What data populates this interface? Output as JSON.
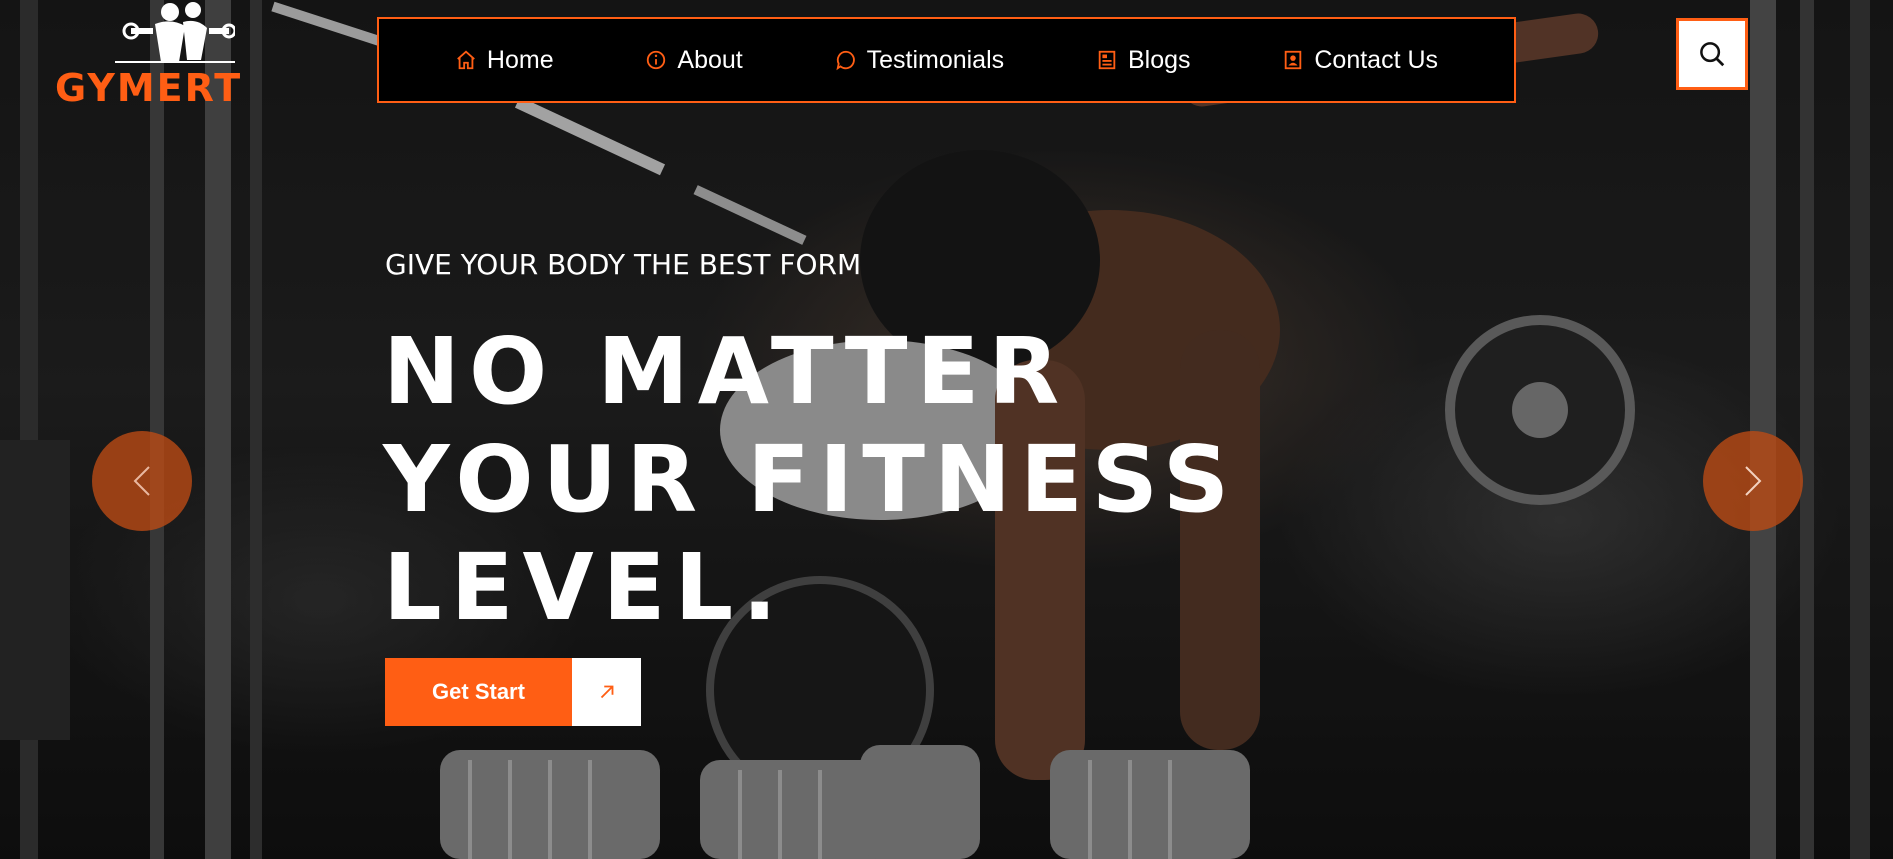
{
  "brand": {
    "name": "GYMERT",
    "accent": "#ff5e14"
  },
  "nav": {
    "items": [
      {
        "label": "Home",
        "icon": "home-icon"
      },
      {
        "label": "About",
        "icon": "info-icon"
      },
      {
        "label": "Testimonials",
        "icon": "chat-bubble-icon"
      },
      {
        "label": "Blogs",
        "icon": "document-icon"
      },
      {
        "label": "Contact Us",
        "icon": "contact-card-icon"
      }
    ]
  },
  "search": {
    "icon": "search-icon"
  },
  "hero": {
    "eyebrow": "GIVE YOUR BODY THE BEST FORM",
    "headline_lines": [
      "NO MATTER",
      "YOUR FITNESS",
      "LEVEL."
    ],
    "cta_label": "Get Start",
    "cta_icon": "arrow-up-right-icon"
  },
  "carousel": {
    "prev_icon": "chevron-left-icon",
    "next_icon": "chevron-right-icon"
  }
}
